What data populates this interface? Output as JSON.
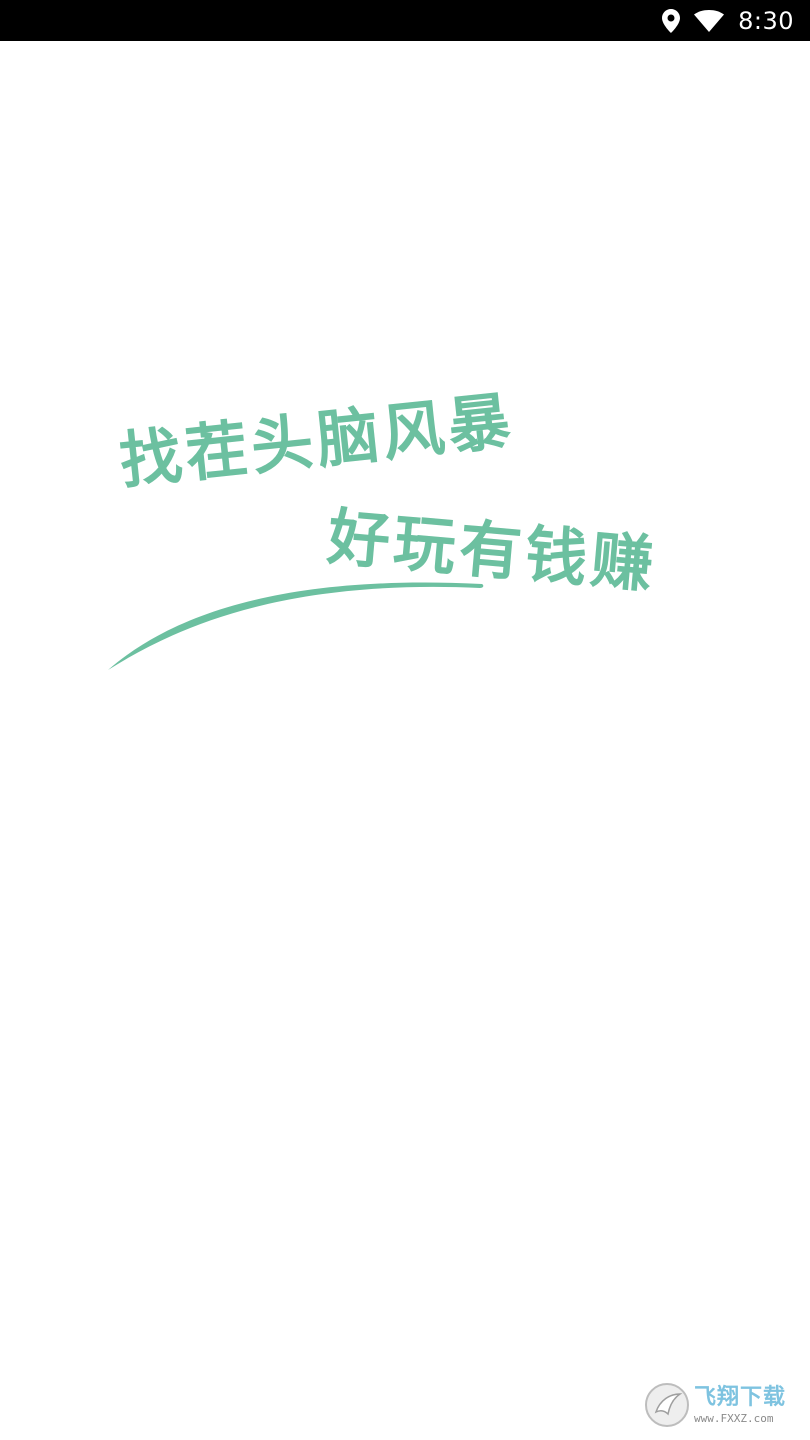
{
  "status_bar": {
    "time": "8:30",
    "icons": [
      "location-icon",
      "wifi-icon"
    ]
  },
  "splash": {
    "slogan_line_1": "找茬头脑风暴",
    "slogan_line_2": "好玩有钱赚",
    "accent_color": "#6cc0a0"
  },
  "watermark": {
    "title": "飞翔下载",
    "url": "www.FXXZ.com"
  }
}
